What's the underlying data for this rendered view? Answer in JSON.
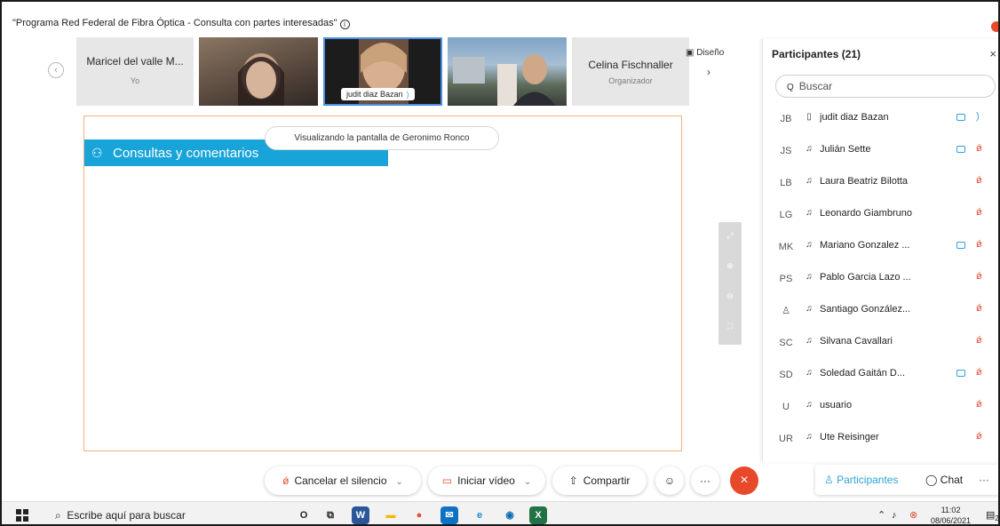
{
  "meeting": {
    "title": "\"Programa Red Federal de Fibra Óptica - Consulta con partes interesadas\"",
    "info_icon": "info-icon"
  },
  "video_strip": {
    "self_name": "Maricel del valle M...",
    "self_role": "Yo",
    "active_speaker_tag": "judit diaz Bazan",
    "organizer_name": "Celina Fischnaller",
    "organizer_role": "Organizador",
    "layout_label": "Diseño"
  },
  "share": {
    "viewing_text": "Visualizando la pantalla de Geronimo Ronco",
    "banner_text": "Consultas y comentarios"
  },
  "participants_panel": {
    "title": "Participantes (21)",
    "search_placeholder": "Buscar",
    "participants": [
      {
        "initials": "JB",
        "name": "judit diaz Bazan",
        "camera": true,
        "mic": "on"
      },
      {
        "initials": "JS",
        "name": "Julián Sette",
        "camera": true,
        "mic": "muted"
      },
      {
        "initials": "LB",
        "name": "Laura Beatriz Bilotta",
        "camera": false,
        "mic": "muted"
      },
      {
        "initials": "LG",
        "name": "Leonardo Giambruno",
        "camera": false,
        "mic": "muted"
      },
      {
        "initials": "MK",
        "name": "Mariano Gonzalez ...",
        "camera": true,
        "mic": "muted"
      },
      {
        "initials": "PS",
        "name": "Pablo Garcia Lazo ...",
        "camera": false,
        "mic": "muted"
      },
      {
        "initials": "",
        "name": "Santiago González...",
        "camera": false,
        "mic": "muted"
      },
      {
        "initials": "SC",
        "name": "Silvana Cavallari",
        "camera": false,
        "mic": "muted"
      },
      {
        "initials": "SD",
        "name": "Soledad Gaitán D...",
        "camera": true,
        "mic": "muted"
      },
      {
        "initials": "U",
        "name": "usuario",
        "camera": false,
        "mic": "muted"
      },
      {
        "initials": "UR",
        "name": "Ute Reisinger",
        "camera": false,
        "mic": "muted"
      }
    ]
  },
  "controls": {
    "mute_label": "Cancelar el silencio",
    "video_label": "Iniciar vídeo",
    "share_label": "Compartir",
    "more_label": "···",
    "participants_label": "Participantes",
    "chat_label": "Chat",
    "overflow_label": "···"
  },
  "taskbar": {
    "search_placeholder": "Escribe aquí para buscar",
    "time": "11:02",
    "date": "08/06/2021",
    "notification_count": "2"
  },
  "colors": {
    "accent": "#2ea3d8",
    "danger": "#e8492a",
    "banner": "#19a4d9",
    "share_border": "#f3b07d"
  }
}
